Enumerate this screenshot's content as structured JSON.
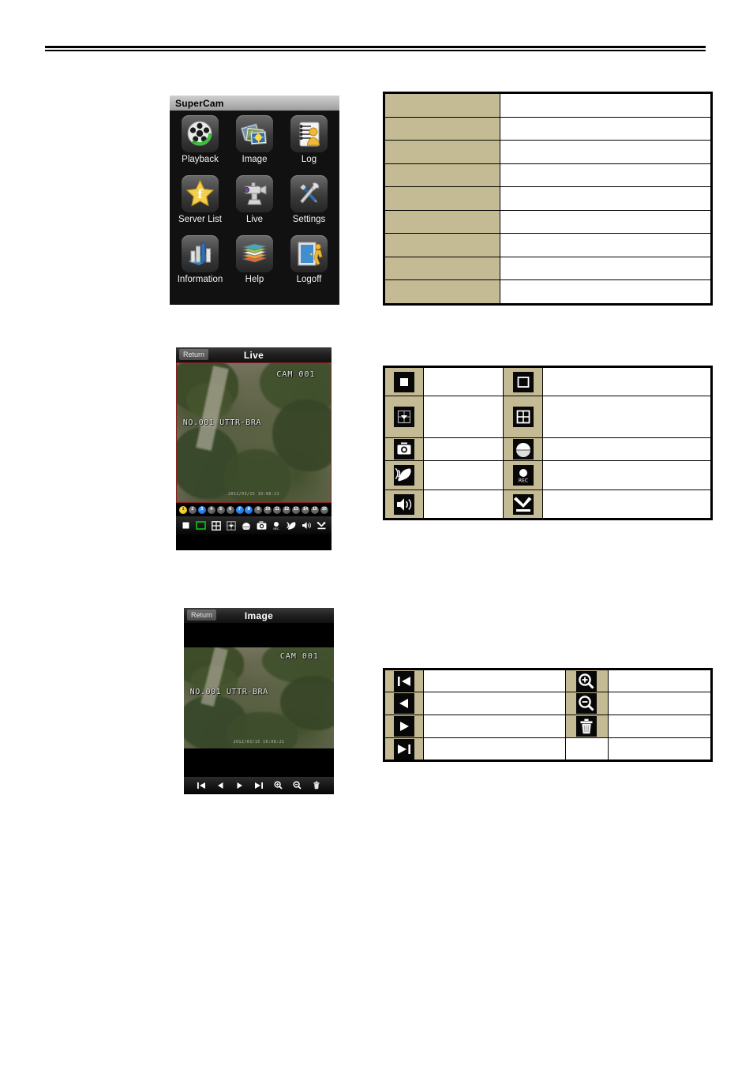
{
  "document": {
    "has_top_rule": true
  },
  "supercam": {
    "title": "SuperCam",
    "items": [
      {
        "label": "Playback",
        "icon": "playback-icon"
      },
      {
        "label": "Image",
        "icon": "image-icon"
      },
      {
        "label": "Log",
        "icon": "log-icon"
      },
      {
        "label": "Server List",
        "icon": "server-list-icon"
      },
      {
        "label": "Live",
        "icon": "live-camera-icon"
      },
      {
        "label": "Settings",
        "icon": "settings-icon"
      },
      {
        "label": "Information",
        "icon": "information-icon"
      },
      {
        "label": "Help",
        "icon": "help-icon"
      },
      {
        "label": "Logoff",
        "icon": "logoff-icon"
      }
    ]
  },
  "live_screen": {
    "return_label": "Return",
    "title": "Live",
    "video": {
      "camera_label": "CAM 001",
      "channel_label": "NO.001 UTTR-BRA",
      "timestamp": "2012/03/15 10:08:21"
    },
    "channels": [
      {
        "number": "1",
        "state": "yellow"
      },
      {
        "number": "2",
        "state": "gray"
      },
      {
        "number": "3",
        "state": "blue"
      },
      {
        "number": "4",
        "state": "gray"
      },
      {
        "number": "5",
        "state": "gray"
      },
      {
        "number": "6",
        "state": "gray"
      },
      {
        "number": "7",
        "state": "blue"
      },
      {
        "number": "8",
        "state": "blue"
      },
      {
        "number": "9",
        "state": "gray"
      },
      {
        "number": "10",
        "state": "gray"
      },
      {
        "number": "11",
        "state": "gray"
      },
      {
        "number": "12",
        "state": "gray"
      },
      {
        "number": "13",
        "state": "gray"
      },
      {
        "number": "14",
        "state": "gray"
      },
      {
        "number": "15",
        "state": "gray"
      },
      {
        "number": "16",
        "state": "gray"
      }
    ],
    "toolbar": [
      {
        "icon": "stop-icon"
      },
      {
        "icon": "single-screen-icon"
      },
      {
        "icon": "four-split-screen-icon"
      },
      {
        "icon": "ptz-icon"
      },
      {
        "icon": "dome-icon"
      },
      {
        "icon": "snapshot-icon"
      },
      {
        "icon": "record-icon"
      },
      {
        "icon": "talk-icon"
      },
      {
        "icon": "audio-icon"
      },
      {
        "icon": "exit-icon"
      }
    ]
  },
  "image_screen": {
    "return_label": "Return",
    "title": "Image",
    "video": {
      "camera_label": "CAM 001",
      "channel_label": "NO.001 UTTR-BRA",
      "timestamp": "2012/03/15 10:08:21"
    },
    "toolbar": [
      {
        "icon": "first-image-icon"
      },
      {
        "icon": "previous-image-icon"
      },
      {
        "icon": "play-icon"
      },
      {
        "icon": "last-image-icon"
      },
      {
        "icon": "zoom-in-icon"
      },
      {
        "icon": "zoom-out-icon"
      },
      {
        "icon": "delete-icon"
      }
    ]
  },
  "tables": {
    "main_menu_table": {
      "rows": [
        {
          "label": "",
          "description": ""
        },
        {
          "label": "",
          "description": ""
        },
        {
          "label": "",
          "description": ""
        },
        {
          "label": "",
          "description": ""
        },
        {
          "label": "",
          "description": ""
        },
        {
          "label": "",
          "description": ""
        },
        {
          "label": "",
          "description": ""
        },
        {
          "label": "",
          "description": ""
        },
        {
          "label": "",
          "description": ""
        }
      ]
    },
    "live_icon_table": {
      "rows": [
        {
          "icon_left": "stop-icon",
          "desc_left": "",
          "icon_right": "single-screen-icon",
          "desc_right": ""
        },
        {
          "icon_left": "ptz-icon",
          "desc_left": "",
          "icon_right": "four-split-screen-icon",
          "desc_right": ""
        },
        {
          "icon_left": "snapshot-icon",
          "desc_left": "",
          "icon_right": "dome-icon",
          "desc_right": ""
        },
        {
          "icon_left": "talk-icon",
          "desc_left": "",
          "icon_right": "record-icon",
          "desc_right": ""
        },
        {
          "icon_left": "audio-icon",
          "desc_left": "",
          "icon_right": "exit-icon",
          "desc_right": ""
        }
      ]
    },
    "image_icon_table": {
      "rows": [
        {
          "icon_left": "first-image-icon",
          "desc_left": "",
          "icon_right": "zoom-in-icon",
          "desc_right": ""
        },
        {
          "icon_left": "previous-image-icon",
          "desc_left": "",
          "icon_right": "zoom-out-icon",
          "desc_right": ""
        },
        {
          "icon_left": "play-icon",
          "desc_left": "",
          "icon_right": "delete-icon",
          "desc_right": ""
        },
        {
          "icon_left": "last-image-icon",
          "desc_left": "",
          "icon_right": "",
          "desc_right": ""
        }
      ]
    }
  },
  "colors": {
    "table_label_bg": "#c4bb94",
    "table_border": "#000000",
    "channel_active": "#ffd400",
    "channel_selected": "#2b7ff0",
    "single_screen_highlight": "#13c413"
  }
}
